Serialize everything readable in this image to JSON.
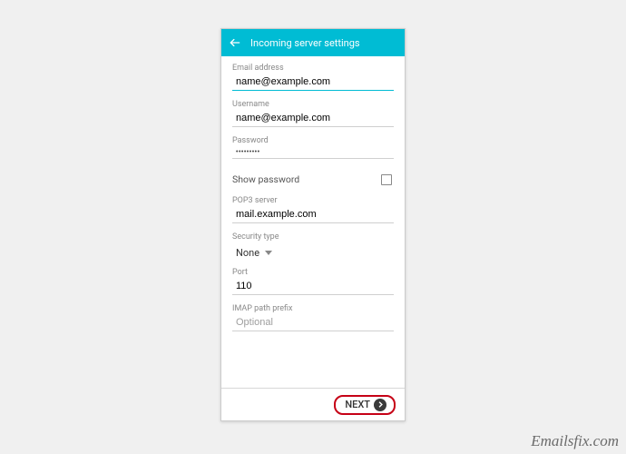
{
  "header": {
    "title": "Incoming server settings"
  },
  "fields": {
    "email": {
      "label": "Email address",
      "value": "name@example.com"
    },
    "username": {
      "label": "Username",
      "value": "name@example.com"
    },
    "password": {
      "label": "Password",
      "value": "•••••••••"
    },
    "showPassword": {
      "label": "Show password"
    },
    "pop3": {
      "label": "POP3 server",
      "value": "mail.example.com"
    },
    "security": {
      "label": "Security type",
      "value": "None"
    },
    "port": {
      "label": "Port",
      "value": "110"
    },
    "imapPrefix": {
      "label": "IMAP path prefix",
      "placeholder": "Optional"
    }
  },
  "footer": {
    "next": "NEXT"
  },
  "watermark": "Emailsfix.com"
}
